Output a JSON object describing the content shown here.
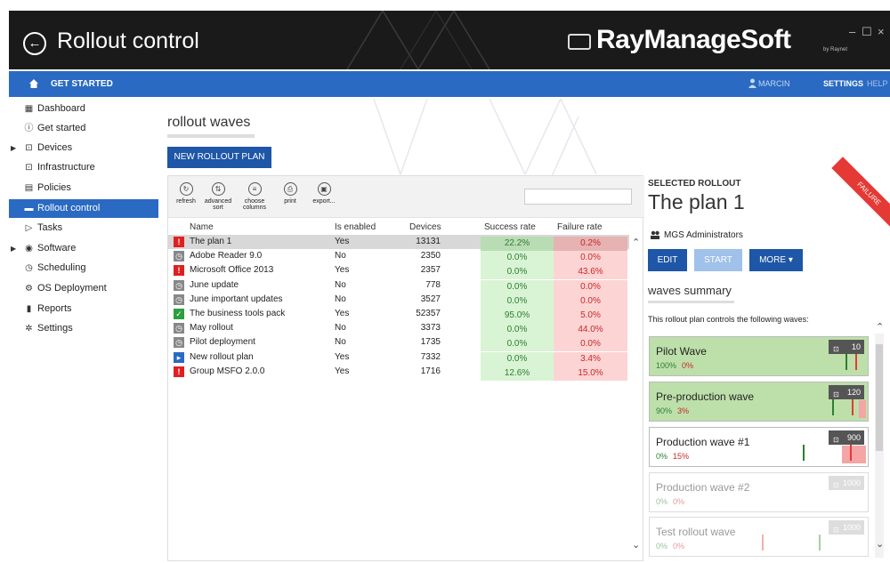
{
  "titlebar": {
    "title": "Rollout control",
    "brand": "RayManageSoft",
    "brand_suffix": "by Raynet",
    "minimize": "–",
    "maximize": "☐",
    "close": "×"
  },
  "navbar": {
    "get_started": "GET STARTED",
    "user": "MARCIN",
    "settings": "SETTINGS",
    "help": "HELP"
  },
  "sidebar": {
    "items": [
      {
        "label": "Dashboard",
        "icon": "dashboard-icon",
        "glyph": "▦",
        "expandable": false,
        "active": false
      },
      {
        "label": "Get started",
        "icon": "info-icon",
        "glyph": "ⓘ",
        "expandable": false,
        "active": false
      },
      {
        "label": "Devices",
        "icon": "devices-icon",
        "glyph": "⊡",
        "expandable": true,
        "active": false
      },
      {
        "label": "Infrastructure",
        "icon": "infrastructure-icon",
        "glyph": "⊡",
        "expandable": false,
        "active": false
      },
      {
        "label": "Policies",
        "icon": "policies-icon",
        "glyph": "▤",
        "expandable": false,
        "active": false
      },
      {
        "label": "Rollout control",
        "icon": "rollout-icon",
        "glyph": "▬",
        "expandable": false,
        "active": true
      },
      {
        "label": "Tasks",
        "icon": "tasks-icon",
        "glyph": "▷",
        "expandable": false,
        "active": false
      },
      {
        "label": "Software",
        "icon": "software-icon",
        "glyph": "◉",
        "expandable": true,
        "active": false
      },
      {
        "label": "Scheduling",
        "icon": "clock-icon",
        "glyph": "◷",
        "expandable": false,
        "active": false
      },
      {
        "label": "OS Deployment",
        "icon": "os-deploy-icon",
        "glyph": "⚙",
        "expandable": false,
        "active": false
      },
      {
        "label": "Reports",
        "icon": "reports-icon",
        "glyph": "▮",
        "expandable": false,
        "active": false
      },
      {
        "label": "Settings",
        "icon": "gear-icon",
        "glyph": "✲",
        "expandable": false,
        "active": false
      }
    ]
  },
  "main": {
    "title": "rollout waves",
    "new_button": "NEW ROLLOUT PLAN",
    "toolbar": [
      {
        "label": "refresh",
        "icon": "refresh-icon",
        "glyph": "↻"
      },
      {
        "label": "advanced sort",
        "icon": "sort-icon",
        "glyph": "⇅"
      },
      {
        "label": "choose columns",
        "icon": "columns-icon",
        "glyph": "≡"
      },
      {
        "label": "print",
        "icon": "print-icon",
        "glyph": "⎙"
      },
      {
        "label": "export...",
        "icon": "export-icon",
        "glyph": "▣"
      }
    ],
    "search_placeholder": "",
    "columns": [
      "Name",
      "Is enabled",
      "Devices",
      "Success rate",
      "Failure rate"
    ],
    "rows": [
      {
        "status": "red",
        "glyph": "!",
        "name": "The plan 1",
        "enabled": "Yes",
        "devices": "13131",
        "success": "22.2%",
        "failure": "0.2%",
        "selected": true
      },
      {
        "status": "gray",
        "glyph": "◷",
        "name": "Adobe Reader 9.0",
        "enabled": "No",
        "devices": "2350",
        "success": "0.0%",
        "failure": "0.0%",
        "selected": false
      },
      {
        "status": "red",
        "glyph": "!",
        "name": "Microsoft Office 2013",
        "enabled": "Yes",
        "devices": "2357",
        "success": "0.0%",
        "failure": "43.6%",
        "selected": false
      },
      {
        "status": "gray",
        "glyph": "◷",
        "name": "June update",
        "enabled": "No",
        "devices": "778",
        "success": "0.0%",
        "failure": "0.0%",
        "selected": false
      },
      {
        "status": "gray",
        "glyph": "◷",
        "name": "June important updates",
        "enabled": "No",
        "devices": "3527",
        "success": "0.0%",
        "failure": "0.0%",
        "selected": false
      },
      {
        "status": "green",
        "glyph": "✓",
        "name": "The business tools pack",
        "enabled": "Yes",
        "devices": "52357",
        "success": "95.0%",
        "failure": "5.0%",
        "selected": false
      },
      {
        "status": "gray",
        "glyph": "◷",
        "name": "May rollout",
        "enabled": "No",
        "devices": "3373",
        "success": "0.0%",
        "failure": "44.0%",
        "selected": false
      },
      {
        "status": "gray",
        "glyph": "◷",
        "name": "Pilot deployment",
        "enabled": "No",
        "devices": "1735",
        "success": "0.0%",
        "failure": "0.0%",
        "selected": false
      },
      {
        "status": "blue",
        "glyph": "▸",
        "name": "New rollout plan",
        "enabled": "Yes",
        "devices": "7332",
        "success": "0.0%",
        "failure": "3.4%",
        "selected": false
      },
      {
        "status": "red",
        "glyph": "!",
        "name": "Group MSFO 2.0.0",
        "enabled": "Yes",
        "devices": "1716",
        "success": "12.6%",
        "failure": "15.0%",
        "selected": false
      }
    ]
  },
  "detail": {
    "label": "SELECTED ROLLOUT",
    "name": "The plan 1",
    "ribbon": "FAILURE",
    "group": "MGS Administrators",
    "edit": "EDIT",
    "start": "START",
    "more": "MORE",
    "waves_title": "waves summary",
    "waves_desc": "This rollout plan controls the following waves:",
    "waves": [
      {
        "name": "Pilot Wave",
        "success": "100%",
        "failure": "0%",
        "count": "10",
        "style": "green"
      },
      {
        "name": "Pre-production wave",
        "success": "90%",
        "failure": "3%",
        "count": "120",
        "style": "green"
      },
      {
        "name": "Production wave #1",
        "success": "0%",
        "failure": "15%",
        "count": "900",
        "style": "white"
      },
      {
        "name": "Production wave #2",
        "success": "0%",
        "failure": "0%",
        "count": "1000",
        "style": "faded"
      },
      {
        "name": "Test rollout wave",
        "success": "0%",
        "failure": "0%",
        "count": "1000",
        "style": "faded"
      }
    ]
  }
}
